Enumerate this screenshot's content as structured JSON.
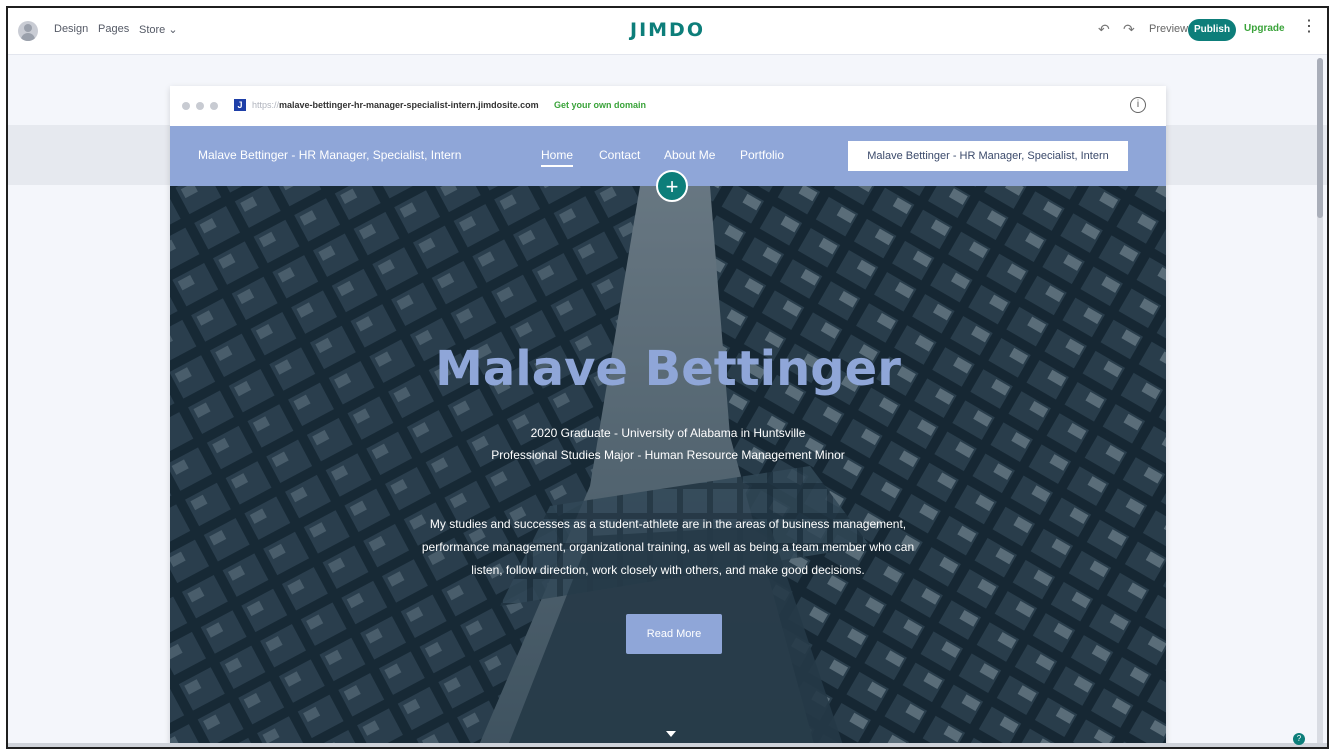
{
  "toolbar": {
    "design": "Design",
    "pages": "Pages",
    "store": "Store",
    "logo": "JIMDO",
    "preview": "Preview",
    "publish": "Publish",
    "upgrade": "Upgrade"
  },
  "browser": {
    "url_protocol": "https://",
    "url_host": "malave-bettinger-hr-manager-specialist-intern.jimdosite.com",
    "domain_link": "Get your own domain"
  },
  "site": {
    "title": "Malave Bettinger - HR Manager, Specialist, Intern",
    "nav": [
      "Home",
      "Contact",
      "About Me",
      "Portfolio"
    ],
    "nav_box": "Malave Bettinger - HR Manager, Specialist, Intern"
  },
  "hero": {
    "heading": "Malave Bettinger",
    "line1": "2020 Graduate - University of Alabama in Huntsville",
    "line2": "Professional Studies Major - Human Resource Management Minor",
    "para1": "My studies and successes as a student-athlete are in the areas of business management,",
    "para2": "performance management, organizational training, as well as being a team member who can",
    "para3": "listen, follow direction, work closely with others, and make good decisions.",
    "button": "Read More"
  },
  "colors": {
    "accent": "#0d7e7a",
    "nav_bg": "#8fa6d8",
    "upgrade": "#3aa33a"
  }
}
